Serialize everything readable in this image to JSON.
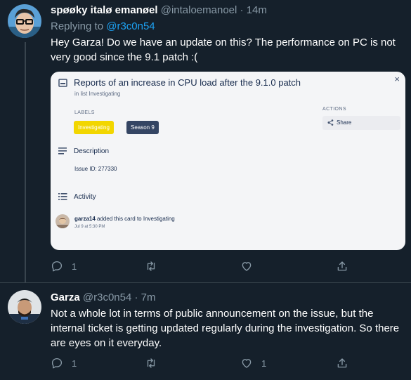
{
  "tweets": [
    {
      "display_name": "spøøky italø emanøel",
      "handle": "@intaloemanoel",
      "separator": "·",
      "time": "14m",
      "replying_to_prefix": "Replying to",
      "replying_to_handle": "@r3c0n54",
      "text": "Hey Garza! Do we have an update on this? The performance on PC is not very good since the 9.1 patch :(",
      "reply_count": "1",
      "retweet_count": "",
      "like_count": ""
    },
    {
      "display_name": "Garza",
      "handle": "@r3c0n54",
      "separator": "·",
      "time": "7m",
      "text": "Not a whole lot in terms of public announcement on the issue, but the internal ticket is getting updated regularly during the investigation. So there are eyes on it everyday.",
      "reply_count": "1",
      "retweet_count": "",
      "like_count": "1"
    }
  ],
  "card": {
    "title": "Reports of an increase in CPU load after the 9.1.0 patch",
    "subtitle": "in list Investigating",
    "close": "×",
    "labels_heading": "LABELS",
    "labels": [
      {
        "text": "Investigating",
        "color": "#f2d600"
      },
      {
        "text": "Season 9",
        "color": "#344563"
      }
    ],
    "actions_heading": "ACTIONS",
    "share_label": "Share",
    "description_heading": "Description",
    "issue_id": "Issue ID: 277330",
    "activity_heading": "Activity",
    "activity_user": "garza14",
    "activity_text": " added this card to Investigating",
    "activity_time": "Jul 9 at 5:30 PM"
  },
  "colors": {
    "background": "#15202b",
    "accent": "#1da1f2",
    "muted": "#8899a6",
    "divider": "#38444d"
  },
  "icons": [
    "reply-icon",
    "retweet-icon",
    "like-icon",
    "share-icon",
    "card-icon",
    "description-icon",
    "activity-icon",
    "share-arrow-icon",
    "close-icon"
  ]
}
